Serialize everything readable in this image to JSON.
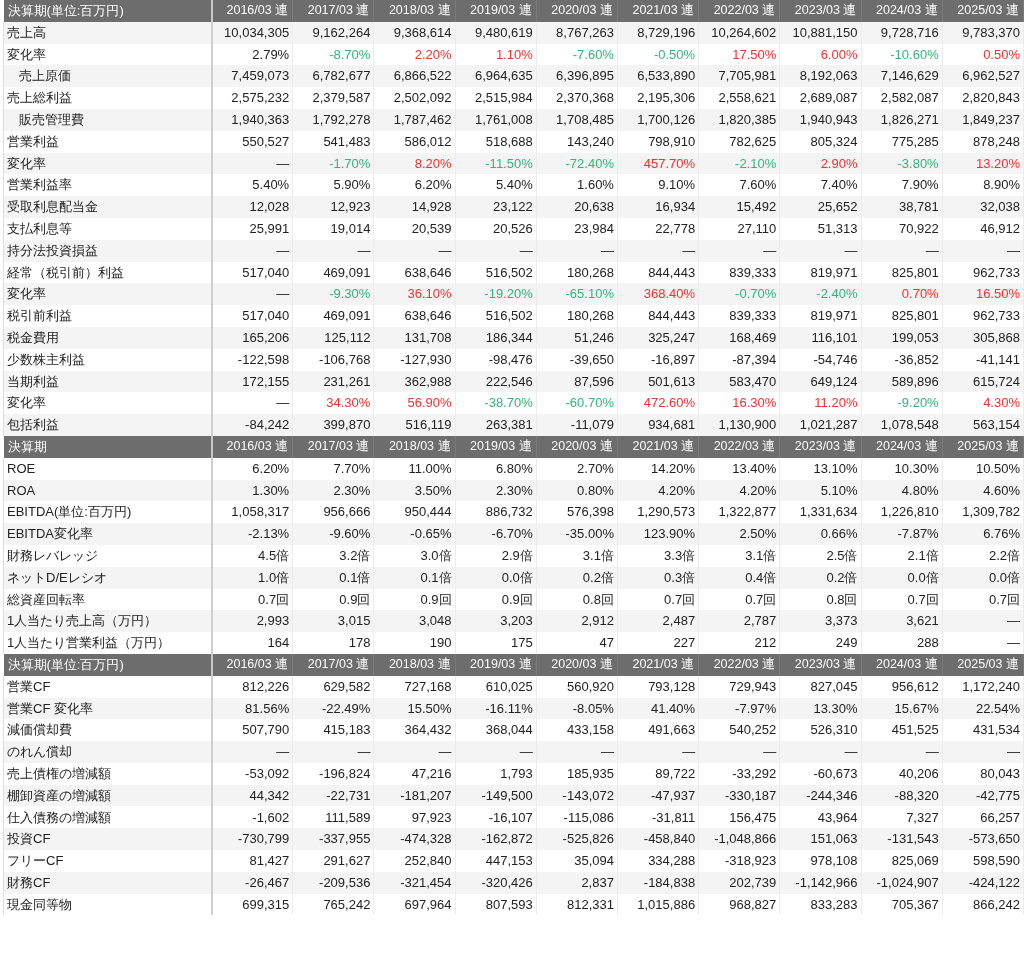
{
  "sections": [
    {
      "header": {
        "label": "決算期(単位:百万円)",
        "columns": [
          "2016/03 連",
          "2017/03 連",
          "2018/03 連",
          "2019/03 連",
          "2020/03 連",
          "2021/03 連",
          "2022/03 連",
          "2023/03 連",
          "2024/03 連",
          "2025/03 連"
        ]
      },
      "rows": [
        {
          "label": "売上高",
          "kind": "item",
          "cells": [
            "10,034,305",
            "9,162,264",
            "9,368,614",
            "9,480,619",
            "8,767,263",
            "8,729,196",
            "10,264,602",
            "10,881,150",
            "9,728,716",
            "9,783,370"
          ]
        },
        {
          "label": "変化率",
          "kind": "item",
          "cells": [
            {
              "text": "2.79%",
              "color": "#222222"
            },
            {
              "text": "-8.70%",
              "color": "#33b37b"
            },
            {
              "text": "2.20%",
              "color": "#f03030"
            },
            {
              "text": "1.10%",
              "color": "#f03030"
            },
            {
              "text": "-7.60%",
              "color": "#33b37b"
            },
            {
              "text": "-0.50%",
              "color": "#33b37b"
            },
            {
              "text": "17.50%",
              "color": "#f03030"
            },
            {
              "text": "6.00%",
              "color": "#f03030"
            },
            {
              "text": "-10.60%",
              "color": "#33b37b"
            },
            {
              "text": "0.50%",
              "color": "#f03030"
            }
          ]
        },
        {
          "label": "売上原価",
          "kind": "sub",
          "cells": [
            "7,459,073",
            "6,782,677",
            "6,866,522",
            "6,964,635",
            "6,396,895",
            "6,533,890",
            "7,705,981",
            "8,192,063",
            "7,146,629",
            "6,962,527"
          ]
        },
        {
          "label": "売上総利益",
          "kind": "item",
          "cells": [
            "2,575,232",
            "2,379,587",
            "2,502,092",
            "2,515,984",
            "2,370,368",
            "2,195,306",
            "2,558,621",
            "2,689,087",
            "2,582,087",
            "2,820,843"
          ]
        },
        {
          "label": "販売管理費",
          "kind": "sub",
          "cells": [
            "1,940,363",
            "1,792,278",
            "1,787,462",
            "1,761,008",
            "1,708,485",
            "1,700,126",
            "1,820,385",
            "1,940,943",
            "1,826,271",
            "1,849,237"
          ]
        },
        {
          "label": "営業利益",
          "kind": "item",
          "cells": [
            "550,527",
            "541,483",
            "586,012",
            "518,688",
            "143,240",
            "798,910",
            "782,625",
            "805,324",
            "775,285",
            "878,248"
          ]
        },
        {
          "label": "変化率",
          "kind": "item",
          "cells": [
            "—",
            {
              "text": "-1.70%",
              "color": "#33b37b"
            },
            {
              "text": "8.20%",
              "color": "#f03030"
            },
            {
              "text": "-11.50%",
              "color": "#33b37b"
            },
            {
              "text": "-72.40%",
              "color": "#33b37b"
            },
            {
              "text": "457.70%",
              "color": "#f03030"
            },
            {
              "text": "-2.10%",
              "color": "#33b37b"
            },
            {
              "text": "2.90%",
              "color": "#f03030"
            },
            {
              "text": "-3.80%",
              "color": "#33b37b"
            },
            {
              "text": "13.20%",
              "color": "#f03030"
            }
          ]
        },
        {
          "label": "営業利益率",
          "kind": "item",
          "cells": [
            "5.40%",
            "5.90%",
            "6.20%",
            "5.40%",
            "1.60%",
            "9.10%",
            "7.60%",
            "7.40%",
            "7.90%",
            "8.90%"
          ]
        },
        {
          "label": "受取利息配当金",
          "kind": "item",
          "cells": [
            "12,028",
            "12,923",
            "14,928",
            "23,122",
            "20,638",
            "16,934",
            "15,492",
            "25,652",
            "38,781",
            "32,038"
          ]
        },
        {
          "label": "支払利息等",
          "kind": "item",
          "cells": [
            "25,991",
            "19,014",
            "20,539",
            "20,526",
            "23,984",
            "22,778",
            "27,110",
            "51,313",
            "70,922",
            "46,912"
          ]
        },
        {
          "label": "持分法投資損益",
          "kind": "item",
          "cells": [
            "—",
            "—",
            "—",
            "—",
            "—",
            "—",
            "—",
            "—",
            "—",
            "—"
          ]
        },
        {
          "label": "経常（税引前）利益",
          "kind": "item",
          "cells": [
            "517,040",
            "469,091",
            "638,646",
            "516,502",
            "180,268",
            "844,443",
            "839,333",
            "819,971",
            "825,801",
            "962,733"
          ]
        },
        {
          "label": "変化率",
          "kind": "item",
          "cells": [
            "—",
            {
              "text": "-9.30%",
              "color": "#33b37b"
            },
            {
              "text": "36.10%",
              "color": "#f03030"
            },
            {
              "text": "-19.20%",
              "color": "#33b37b"
            },
            {
              "text": "-65.10%",
              "color": "#33b37b"
            },
            {
              "text": "368.40%",
              "color": "#f03030"
            },
            {
              "text": "-0.70%",
              "color": "#33b37b"
            },
            {
              "text": "-2.40%",
              "color": "#33b37b"
            },
            {
              "text": "0.70%",
              "color": "#f03030"
            },
            {
              "text": "16.50%",
              "color": "#f03030"
            }
          ]
        },
        {
          "label": "税引前利益",
          "kind": "item",
          "cells": [
            "517,040",
            "469,091",
            "638,646",
            "516,502",
            "180,268",
            "844,443",
            "839,333",
            "819,971",
            "825,801",
            "962,733"
          ]
        },
        {
          "label": "税金費用",
          "kind": "item",
          "cells": [
            "165,206",
            "125,112",
            "131,708",
            "186,344",
            "51,246",
            "325,247",
            "168,469",
            "116,101",
            "199,053",
            "305,868"
          ]
        },
        {
          "label": "少数株主利益",
          "kind": "item",
          "cells": [
            "-122,598",
            "-106,768",
            "-127,930",
            "-98,476",
            "-39,650",
            "-16,897",
            "-87,394",
            "-54,746",
            "-36,852",
            "-41,141"
          ]
        },
        {
          "label": "当期利益",
          "kind": "item",
          "cells": [
            "172,155",
            "231,261",
            "362,988",
            "222,546",
            "87,596",
            "501,613",
            "583,470",
            "649,124",
            "589,896",
            "615,724"
          ]
        },
        {
          "label": "変化率",
          "kind": "item",
          "cells": [
            "—",
            {
              "text": "34.30%",
              "color": "#f03030"
            },
            {
              "text": "56.90%",
              "color": "#f03030"
            },
            {
              "text": "-38.70%",
              "color": "#33b37b"
            },
            {
              "text": "-60.70%",
              "color": "#33b37b"
            },
            {
              "text": "472.60%",
              "color": "#f03030"
            },
            {
              "text": "16.30%",
              "color": "#f03030"
            },
            {
              "text": "11.20%",
              "color": "#f03030"
            },
            {
              "text": "-9.20%",
              "color": "#33b37b"
            },
            {
              "text": "4.30%",
              "color": "#f03030"
            }
          ]
        },
        {
          "label": "包括利益",
          "kind": "item",
          "cells": [
            "-84,242",
            "399,870",
            "516,119",
            "263,381",
            "-11,079",
            "934,681",
            "1,130,900",
            "1,021,287",
            "1,078,548",
            "563,154"
          ]
        }
      ]
    },
    {
      "header": {
        "label": "決算期",
        "columns": [
          "2016/03 連",
          "2017/03 連",
          "2018/03 連",
          "2019/03 連",
          "2020/03 連",
          "2021/03 連",
          "2022/03 連",
          "2023/03 連",
          "2024/03 連",
          "2025/03 連"
        ]
      },
      "rows": [
        {
          "label": "ROE",
          "kind": "item",
          "cells": [
            "6.20%",
            "7.70%",
            "11.00%",
            "6.80%",
            "2.70%",
            "14.20%",
            "13.40%",
            "13.10%",
            "10.30%",
            "10.50%"
          ]
        },
        {
          "label": "ROA",
          "kind": "item",
          "cells": [
            "1.30%",
            "2.30%",
            "3.50%",
            "2.30%",
            "0.80%",
            "4.20%",
            "4.20%",
            "5.10%",
            "4.80%",
            "4.60%"
          ]
        },
        {
          "label": "EBITDA(単位:百万円)",
          "kind": "item",
          "cells": [
            "1,058,317",
            "956,666",
            "950,444",
            "886,732",
            "576,398",
            "1,290,573",
            "1,322,877",
            "1,331,634",
            "1,226,810",
            "1,309,782"
          ]
        },
        {
          "label": "EBITDA変化率",
          "kind": "item",
          "cells": [
            "-2.13%",
            "-9.60%",
            "-0.65%",
            "-6.70%",
            "-35.00%",
            "123.90%",
            "2.50%",
            "0.66%",
            "-7.87%",
            "6.76%"
          ]
        },
        {
          "label": "財務レバレッジ",
          "kind": "item",
          "cells": [
            "4.5倍",
            "3.2倍",
            "3.0倍",
            "2.9倍",
            "3.1倍",
            "3.3倍",
            "3.1倍",
            "2.5倍",
            "2.1倍",
            "2.2倍"
          ]
        },
        {
          "label": "ネットD/Eレシオ",
          "kind": "item",
          "cells": [
            "1.0倍",
            "0.1倍",
            "0.1倍",
            "0.0倍",
            "0.2倍",
            "0.3倍",
            "0.4倍",
            "0.2倍",
            "0.0倍",
            "0.0倍"
          ]
        },
        {
          "label": "総資産回転率",
          "kind": "item",
          "cells": [
            "0.7回",
            "0.9回",
            "0.9回",
            "0.9回",
            "0.8回",
            "0.7回",
            "0.7回",
            "0.8回",
            "0.7回",
            "0.7回"
          ]
        },
        {
          "label": "1人当たり売上高（万円）",
          "kind": "item",
          "cells": [
            "2,993",
            "3,015",
            "3,048",
            "3,203",
            "2,912",
            "2,487",
            "2,787",
            "3,373",
            "3,621",
            "—"
          ]
        },
        {
          "label": "1人当たり営業利益（万円）",
          "kind": "item",
          "cells": [
            "164",
            "178",
            "190",
            "175",
            "47",
            "227",
            "212",
            "249",
            "288",
            "—"
          ]
        }
      ]
    },
    {
      "header": {
        "label": "決算期(単位:百万円)",
        "columns": [
          "2016/03 連",
          "2017/03 連",
          "2018/03 連",
          "2019/03 連",
          "2020/03 連",
          "2021/03 連",
          "2022/03 連",
          "2023/03 連",
          "2024/03 連",
          "2025/03 連"
        ]
      },
      "rows": [
        {
          "label": "営業CF",
          "kind": "item",
          "cells": [
            "812,226",
            "629,582",
            "727,168",
            "610,025",
            "560,920",
            "793,128",
            "729,943",
            "827,045",
            "956,612",
            "1,172,240"
          ]
        },
        {
          "label": "営業CF 変化率",
          "kind": "item",
          "cells": [
            "81.56%",
            "-22.49%",
            "15.50%",
            "-16.11%",
            "-8.05%",
            "41.40%",
            "-7.97%",
            "13.30%",
            "15.67%",
            "22.54%"
          ]
        },
        {
          "label": "減価償却費",
          "kind": "item",
          "cells": [
            "507,790",
            "415,183",
            "364,432",
            "368,044",
            "433,158",
            "491,663",
            "540,252",
            "526,310",
            "451,525",
            "431,534"
          ]
        },
        {
          "label": "のれん償却",
          "kind": "item",
          "cells": [
            "—",
            "—",
            "—",
            "—",
            "—",
            "—",
            "—",
            "—",
            "—",
            "—"
          ]
        },
        {
          "label": "売上債権の増減額",
          "kind": "item",
          "cells": [
            "-53,092",
            "-196,824",
            "47,216",
            "1,793",
            "185,935",
            "89,722",
            "-33,292",
            "-60,673",
            "40,206",
            "80,043"
          ]
        },
        {
          "label": "棚卸資産の増減額",
          "kind": "item",
          "cells": [
            "44,342",
            "-22,731",
            "-181,207",
            "-149,500",
            "-143,072",
            "-47,937",
            "-330,187",
            "-244,346",
            "-88,320",
            "-42,775"
          ]
        },
        {
          "label": "仕入債務の増減額",
          "kind": "item",
          "cells": [
            "-1,602",
            "111,589",
            "97,923",
            "-16,107",
            "-115,086",
            "-31,811",
            "156,475",
            "43,964",
            "7,327",
            "66,257"
          ]
        },
        {
          "label": "投資CF",
          "kind": "item",
          "cells": [
            "-730,799",
            "-337,955",
            "-474,328",
            "-162,872",
            "-525,826",
            "-458,840",
            "-1,048,866",
            "151,063",
            "-131,543",
            "-573,650"
          ]
        },
        {
          "label": "フリーCF",
          "kind": "item",
          "cells": [
            "81,427",
            "291,627",
            "252,840",
            "447,153",
            "35,094",
            "334,288",
            "-318,923",
            "978,108",
            "825,069",
            "598,590"
          ]
        },
        {
          "label": "財務CF",
          "kind": "item",
          "cells": [
            "-26,467",
            "-209,536",
            "-321,454",
            "-320,426",
            "2,837",
            "-184,838",
            "202,739",
            "-1,142,966",
            "-1,024,907",
            "-424,122"
          ]
        },
        {
          "label": "現金同等物",
          "kind": "item",
          "cells": [
            "699,315",
            "765,242",
            "697,964",
            "807,593",
            "812,331",
            "1,015,886",
            "968,827",
            "833,283",
            "705,367",
            "866,242"
          ]
        }
      ]
    }
  ]
}
